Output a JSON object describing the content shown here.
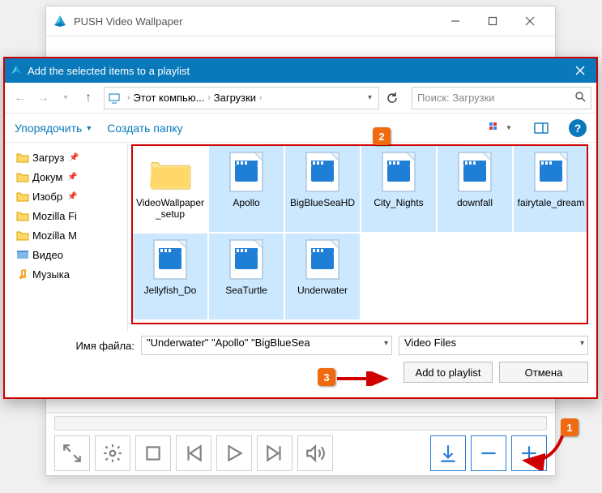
{
  "parent_window": {
    "title": "PUSH Video Wallpaper"
  },
  "dialog": {
    "title": "Add the selected items to a playlist",
    "breadcrumb": {
      "seg1": "Этот компью...",
      "seg2": "Загрузки"
    },
    "search_placeholder": "Поиск: Загрузки",
    "toolbar": {
      "organize": "Упорядочить",
      "new_folder": "Создать папку"
    },
    "tree": [
      {
        "label": "Загруз",
        "pinned": true,
        "kind": "folder"
      },
      {
        "label": "Докум",
        "pinned": true,
        "kind": "folder"
      },
      {
        "label": "Изобр",
        "pinned": true,
        "kind": "folder"
      },
      {
        "label": "Mozilla Fi",
        "pinned": false,
        "kind": "folder"
      },
      {
        "label": "Mozilla M",
        "pinned": false,
        "kind": "folder"
      },
      {
        "label": "Видео",
        "pinned": false,
        "kind": "video"
      },
      {
        "label": "Музыка",
        "pinned": false,
        "kind": "music"
      }
    ],
    "files": [
      {
        "name": "VideoWallpaper_setup",
        "type": "folder",
        "selected": false
      },
      {
        "name": "Apollo",
        "type": "video",
        "selected": true
      },
      {
        "name": "BigBlueSeaHD",
        "type": "video",
        "selected": true
      },
      {
        "name": "City_Nights",
        "type": "video",
        "selected": true
      },
      {
        "name": "downfall",
        "type": "video",
        "selected": true
      },
      {
        "name": "fairytale_dream",
        "type": "video",
        "selected": true
      },
      {
        "name": "Jellyfish_Do",
        "type": "video",
        "selected": true
      },
      {
        "name": "SeaTurtle",
        "type": "video",
        "selected": true
      },
      {
        "name": "Underwater",
        "type": "video",
        "selected": true
      }
    ],
    "filename_label": "Имя файла:",
    "filename_value": "\"Underwater\" \"Apollo\" \"BigBlueSea",
    "filetype_value": "Video Files",
    "btn_add": "Add to playlist",
    "btn_cancel": "Отмена"
  },
  "callouts": {
    "c1": "1",
    "c2": "2",
    "c3": "3"
  }
}
